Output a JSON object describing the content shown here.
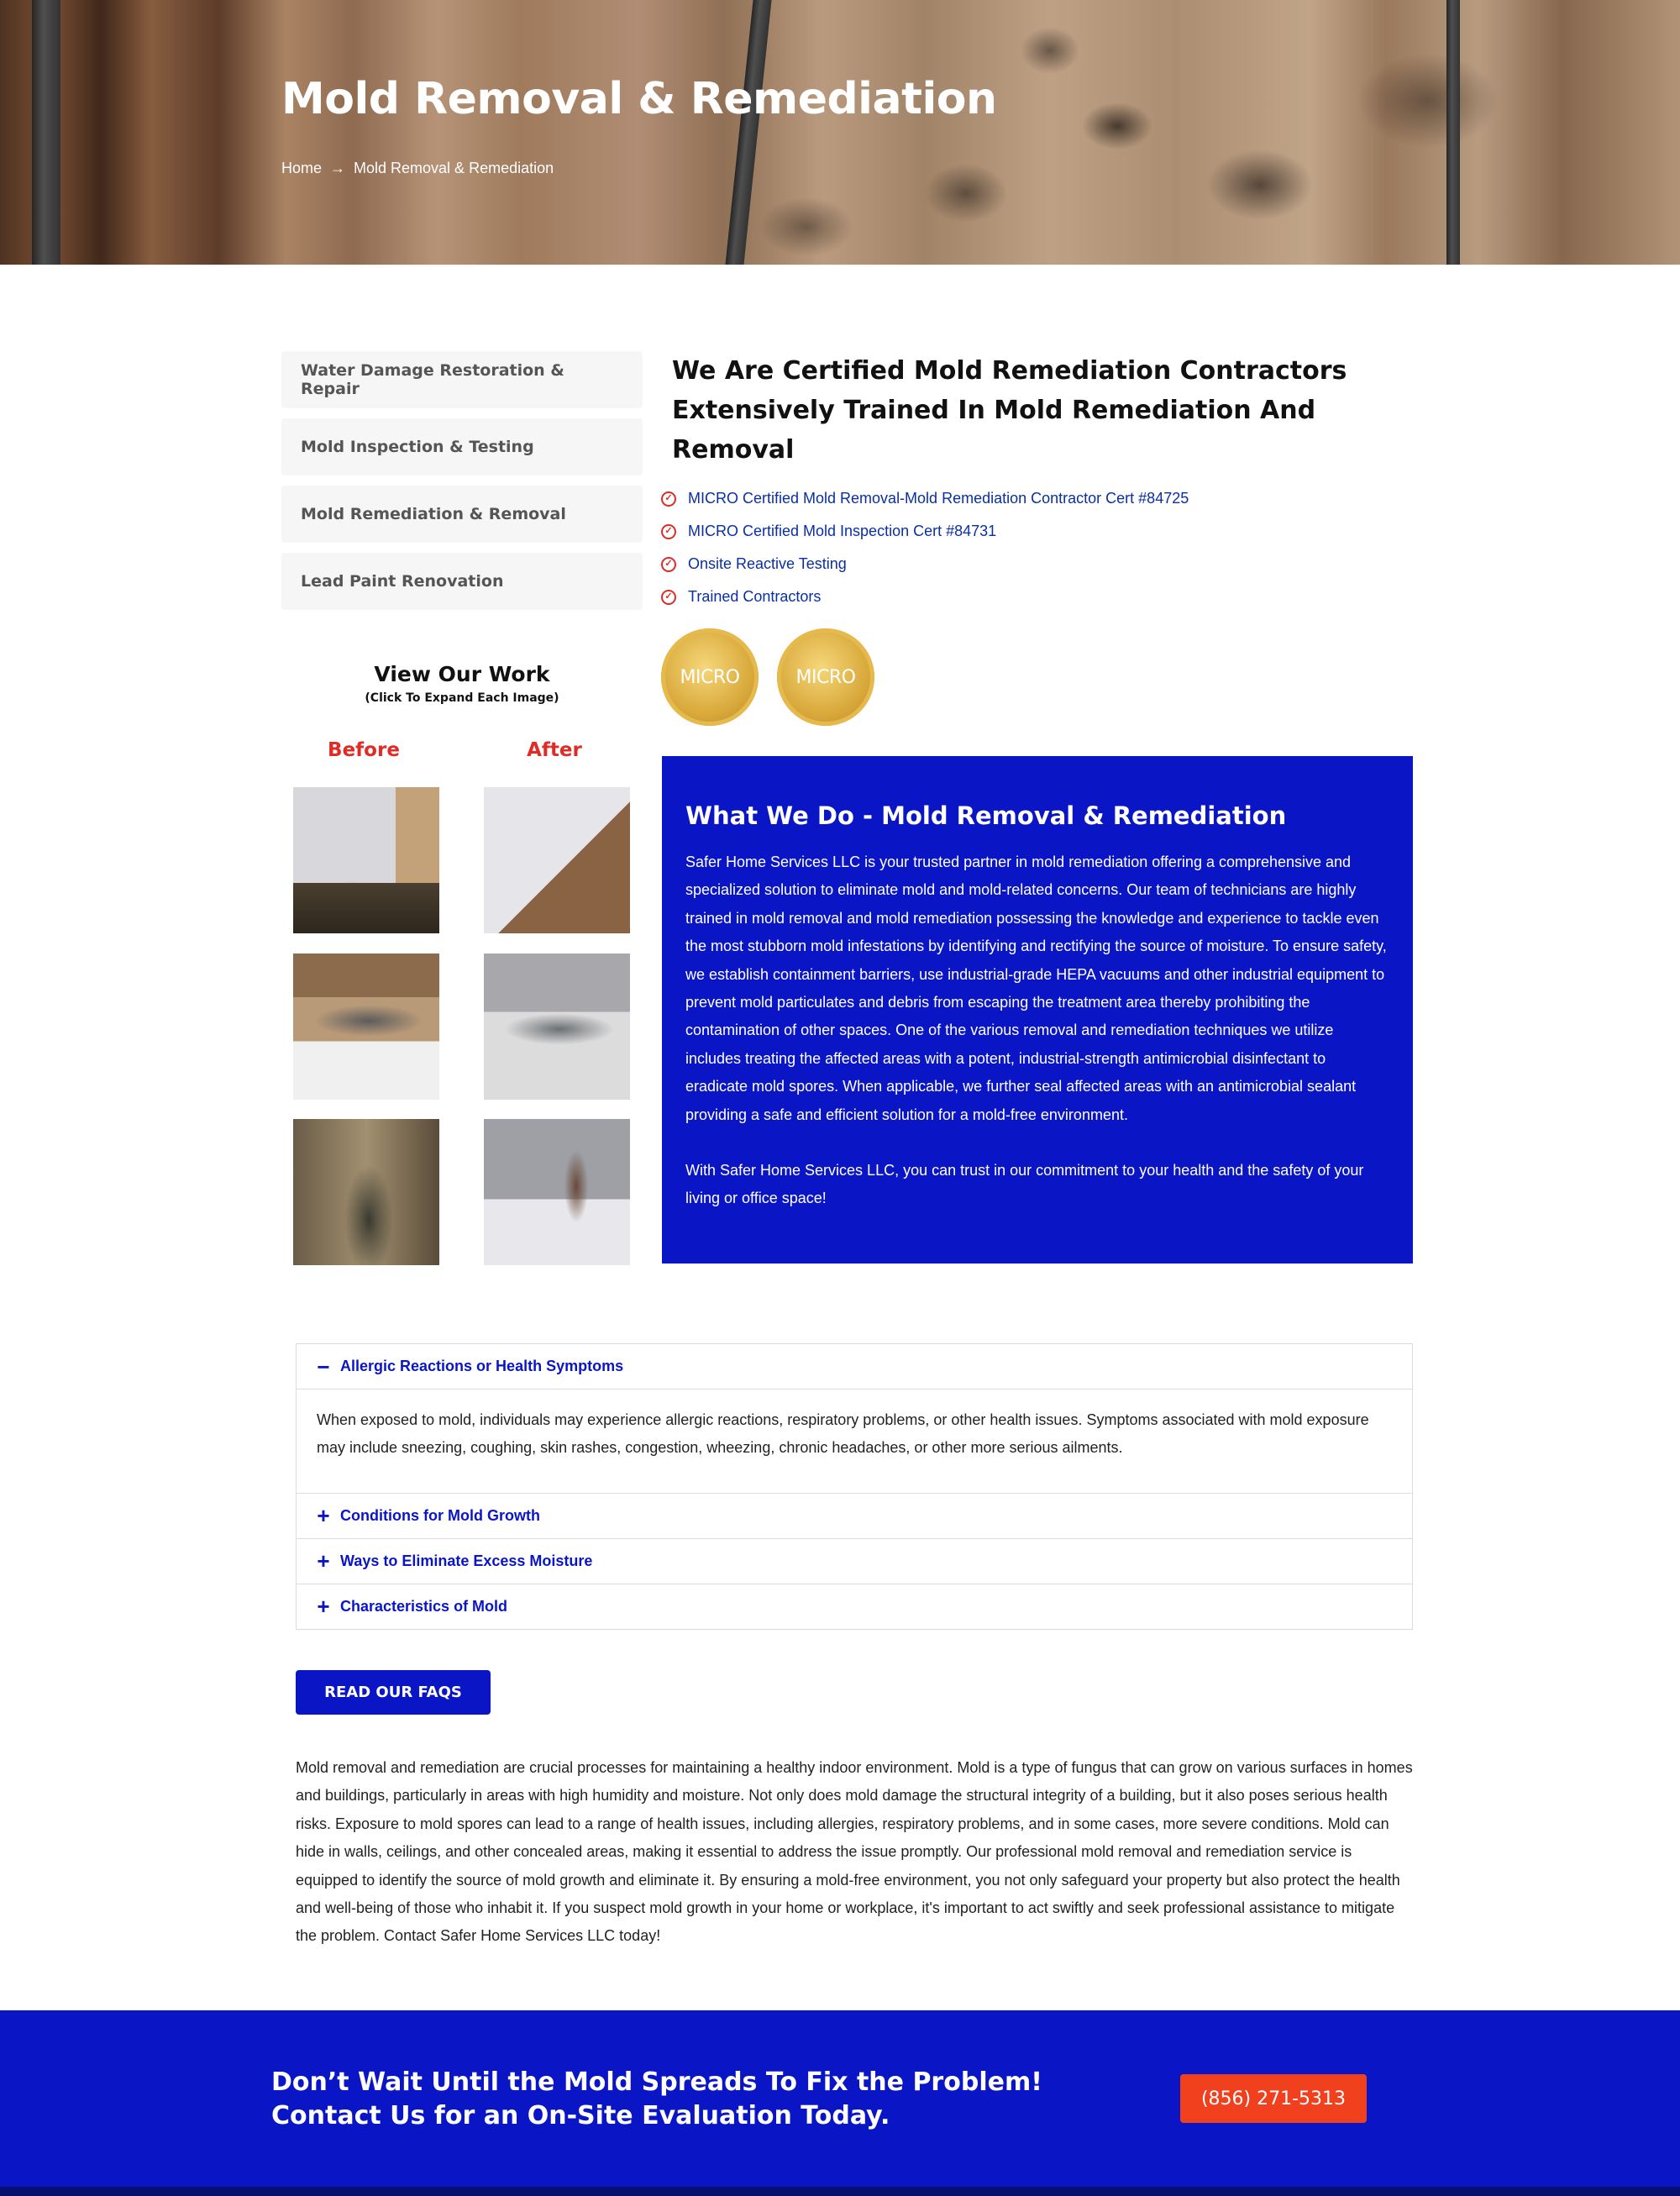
{
  "hero": {
    "title": "Mold Removal & Remediation",
    "breadcrumb": {
      "home": "Home",
      "separator": "→",
      "current": "Mold Removal & Remediation"
    }
  },
  "sidebar": {
    "items": [
      {
        "label": "Water Damage Restoration & Repair"
      },
      {
        "label": "Mold Inspection & Testing"
      },
      {
        "label": "Mold Remediation & Removal"
      },
      {
        "label": "Lead Paint Renovation"
      }
    ]
  },
  "work": {
    "title": "View Our Work",
    "subtitle": "(Click To Expand Each Image)",
    "before_label": "Before",
    "after_label": "After"
  },
  "main": {
    "heading": "We Are Certified Mold Remediation Contractors Extensively Trained In Mold Remediation And Removal",
    "certs": [
      {
        "text": "MICRO Certified Mold Removal-Mold Remediation Contractor Cert #84725"
      },
      {
        "text": "MICRO Certified Mold Inspection Cert #84731"
      },
      {
        "text": "Onsite Reactive Testing"
      },
      {
        "text": "Trained Contractors"
      }
    ],
    "badges": [
      {
        "text": "MICRO"
      },
      {
        "text": "MICRO"
      }
    ]
  },
  "what_we_do": {
    "title": "What We Do - Mold Removal & Remediation",
    "para1": "Safer Home Services LLC is your trusted partner in mold remediation offering a comprehensive and specialized solution to eliminate mold and mold-related concerns. Our team of technicians are highly trained in mold removal and mold remediation possessing the knowledge and experience to tackle even the most stubborn mold infestations by identifying and rectifying the source of moisture. To ensure safety, we establish containment barriers, use industrial-grade HEPA vacuums and other industrial equipment to prevent mold particulates and debris from escaping the treatment area thereby prohibiting the contamination of other spaces. One of the various removal and remediation techniques we utilize includes treating the affected areas with a potent, industrial-strength antimicrobial disinfectant to eradicate mold spores. When applicable, we further seal affected areas with an antimicrobial sealant providing a safe and efficient solution for a mold-free environment.",
    "para2": "With Safer Home Services LLC, you can trust in our commitment to your health and the safety of your living or office space!"
  },
  "accordion": {
    "items": [
      {
        "title": "Allergic Reactions or Health Symptoms",
        "symbol": "−",
        "body": "When exposed to mold, individuals may experience allergic reactions, respiratory problems, or other health issues. Symptoms associated with mold exposure may include sneezing, coughing, skin rashes, congestion, wheezing, chronic headaches, or other more serious ailments."
      },
      {
        "title": "Conditions for Mold Growth",
        "symbol": "+"
      },
      {
        "title": "Ways to Eliminate Excess Moisture",
        "symbol": "+"
      },
      {
        "title": "Characteristics of Mold",
        "symbol": "+"
      }
    ]
  },
  "faq_button": "READ OUR FAQS",
  "body_text": "Mold removal and remediation are crucial processes for maintaining a healthy indoor environment. Mold is a type of fungus that can grow on various surfaces in homes and buildings, particularly in areas with high humidity and moisture. Not only does mold damage the structural integrity of a building, but it also poses serious health risks. Exposure to mold spores can lead to a range of health issues, including allergies, respiratory problems, and in some cases, more severe conditions. Mold can hide in walls, ceilings, and other concealed areas, making it essential to address the issue promptly. Our professional mold removal and remediation service is equipped to identify the source of mold growth and eliminate it. By ensuring a mold-free environment, you not only safeguard your property but also protect the health and well-being of those who inhabit it. If you suspect mold growth in your home or workplace, it's important to act swiftly and seek professional assistance to mitigate the problem. Contact Safer Home Services LLC today!",
  "cta": {
    "text": "Don’t Wait Until the Mold Spreads To Fix the Problem! Contact Us for an On-Site Evaluation Today.",
    "phone": "(856) 271-5313"
  },
  "colors": {
    "brand_blue": "#0a16c6",
    "accent_red": "#e02b27",
    "cta_orange": "#f0401e",
    "link_blue": "#0a2fa3"
  }
}
